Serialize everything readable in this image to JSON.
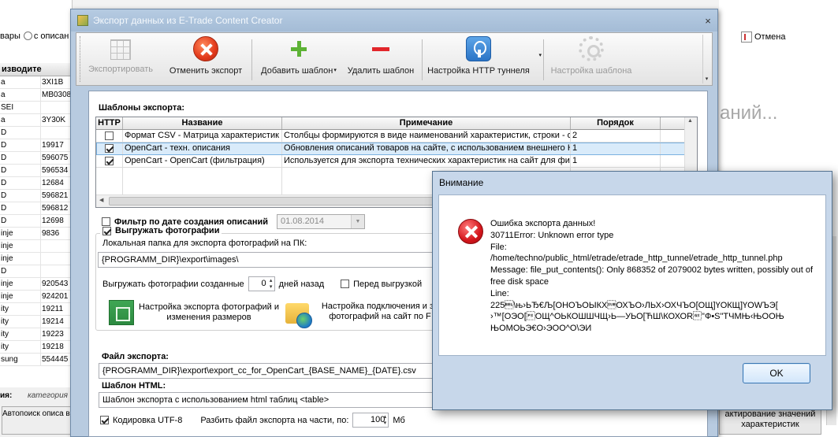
{
  "background": {
    "top_row_text_a": "вары",
    "top_row_text_b": "с описан",
    "grid_header": "изводите",
    "rows": [
      [
        "а",
        "3XI1B"
      ],
      [
        "а",
        "MB0308"
      ],
      [
        "SEI",
        ""
      ],
      [
        "а",
        "3Y30K"
      ],
      [
        "D",
        ""
      ],
      [
        "D",
        "19917"
      ],
      [
        "D",
        "596075"
      ],
      [
        "D",
        "596534"
      ],
      [
        "D",
        "12684"
      ],
      [
        "D",
        "596821"
      ],
      [
        "D",
        "596812"
      ],
      [
        "D",
        "12698"
      ],
      [
        "inje",
        "9836"
      ],
      [
        "inje",
        ""
      ],
      [
        "inje",
        ""
      ],
      [
        "D",
        ""
      ],
      [
        "inje",
        "920543"
      ],
      [
        "inje",
        "924201"
      ],
      [
        "ity",
        "19211"
      ],
      [
        "ity",
        "19214"
      ],
      [
        "ity",
        "19223"
      ],
      [
        "ity",
        "19218"
      ],
      [
        "sung",
        "554445"
      ]
    ],
    "bottom_label": "ия:",
    "bottom_italic": "категория",
    "bottom_button": "Автопоиск описа выбранного т",
    "cancel_label": "Отмена",
    "ghost_text": "аний...",
    "right_button": "актирование значений характеристик"
  },
  "window": {
    "title": "Экспорт данных из E-Trade Content Creator",
    "close_glyph": "×"
  },
  "toolbar": {
    "export": "Экспортировать",
    "cancel_export": "Отменить экспорт",
    "add_template": "Добавить шаблон",
    "delete_template": "Удалить шаблон",
    "http_tunnel": "Настройка HTTP туннеля",
    "template_settings": "Настройка шаблона",
    "dropdown_glyph": "▾"
  },
  "templates": {
    "title": "Шаблоны экспорта:",
    "columns": [
      "HTTP",
      "Название",
      "Примечание",
      "Порядок"
    ],
    "rows": [
      {
        "http": false,
        "name": "Формат CSV - Матрица характеристик",
        "note": "Столбцы формируются в виде наименований характеристик, строки - описания",
        "order": "2"
      },
      {
        "http": true,
        "name": "OpenCart - техн. описания",
        "note": "Обновления описаний товаров на сайте, с использованием внешнего HTTP тоннеля",
        "order": "1"
      },
      {
        "http": true,
        "name": "OpenCart - OpenCart (фильтрация)",
        "note": "Используется для экспорта технических характеристик на сайт для фильтрации",
        "order": "1"
      }
    ]
  },
  "filter": {
    "label": "Фильтр по дате создания описаний",
    "date": "01.08.2014"
  },
  "photos": {
    "label": "Выгружать фотографии",
    "folder_label": "Локальная папка для экспорта фотографий на ПК:",
    "folder_value": "{PROGRAMM_DIR}\\export\\images\\",
    "created_label": "Выгружать фотографии созданные",
    "days_value": "0",
    "days_suffix": "дней назад",
    "before_upload": "Перед выгрузкой",
    "resize_link": "Настройка экспорта фотографий и изменения размеров",
    "connect_link": "Настройка подключения и за фотографий на сайт по F"
  },
  "export_file": {
    "label": "Файл экспорта:",
    "value": "{PROGRAMM_DIR}\\export\\export_cc_for_OpenCart_{BASE_NAME}_{DATE}.csv"
  },
  "html_template": {
    "label": "Шаблон HTML:",
    "value": "Шаблон экспорта с использованием html таблиц <table>"
  },
  "encoding": {
    "label": "Кодировка UTF-8",
    "split_label": "Разбить файл экспорта на части, по:",
    "split_value": "100",
    "split_unit": "Мб"
  },
  "dialog": {
    "title": "Внимание",
    "message": "Ошибка экспорта данных!\n30711Error: Unknown error type\nFile:\n/home/techno/public_html/etrade/etrade_http_tunnel/etrade_http_tunnel.php\nMessage: file_put_contents(): Only 868352 of 2079002 bytes written, possibly out of free disk space\nLine:\n225\u0007\\њ›ЬЂ€Љ[ОНОЪОЫКХ\u001aОХЪО›ЛЬХ›ОХЧЪО[ОЩ]ҮОКЩ]ҮОWЪЭ[\n›™[ОЭО[\u001cОЩ^ОЬКОШШЧЩ›Ь—УЬО[ЋШ\\КОХОR\u001d\"Ф•S\"ТЧМЊ‹ЊООЊ\nЊОМОЬЭ€О›ЭОО^О\\ЭИ",
    "ok": "OK"
  }
}
